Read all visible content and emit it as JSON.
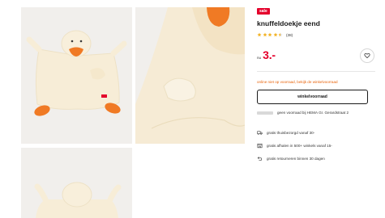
{
  "gallery": {
    "images": [
      {
        "alt": "knuffeldoekje eend"
      },
      {
        "alt": "knuffeldoekje eend detail"
      },
      {
        "alt": "knuffeldoekje eend achterkant"
      }
    ]
  },
  "product": {
    "badge": "sale",
    "title": "knuffeldoekje eend",
    "rating_value": 4.5,
    "rating_count": "(38)",
    "price_prefix": "nu",
    "price": "3.-"
  },
  "availability": {
    "notice": "online niet op voorraad, bekijk de winkelvoorraad",
    "store_button": "winkelvoorraad",
    "stock_text": "geen voorraad bij HEMA Gr. Gerardstraat 2"
  },
  "usps": [
    {
      "icon": "truck-icon",
      "text": "gratis thuisbezorgd vanaf 30-"
    },
    {
      "icon": "store-icon",
      "text": "gratis afhalen in 500+ winkels vanaf 15-"
    },
    {
      "icon": "return-icon",
      "text": "gratis retourneren binnen 30 dagen"
    }
  ],
  "colors": {
    "brand_red": "#e4002b",
    "notice_orange": "#e8630a",
    "star_gold": "#f2b01e",
    "photo_bg": "#f1efec"
  }
}
